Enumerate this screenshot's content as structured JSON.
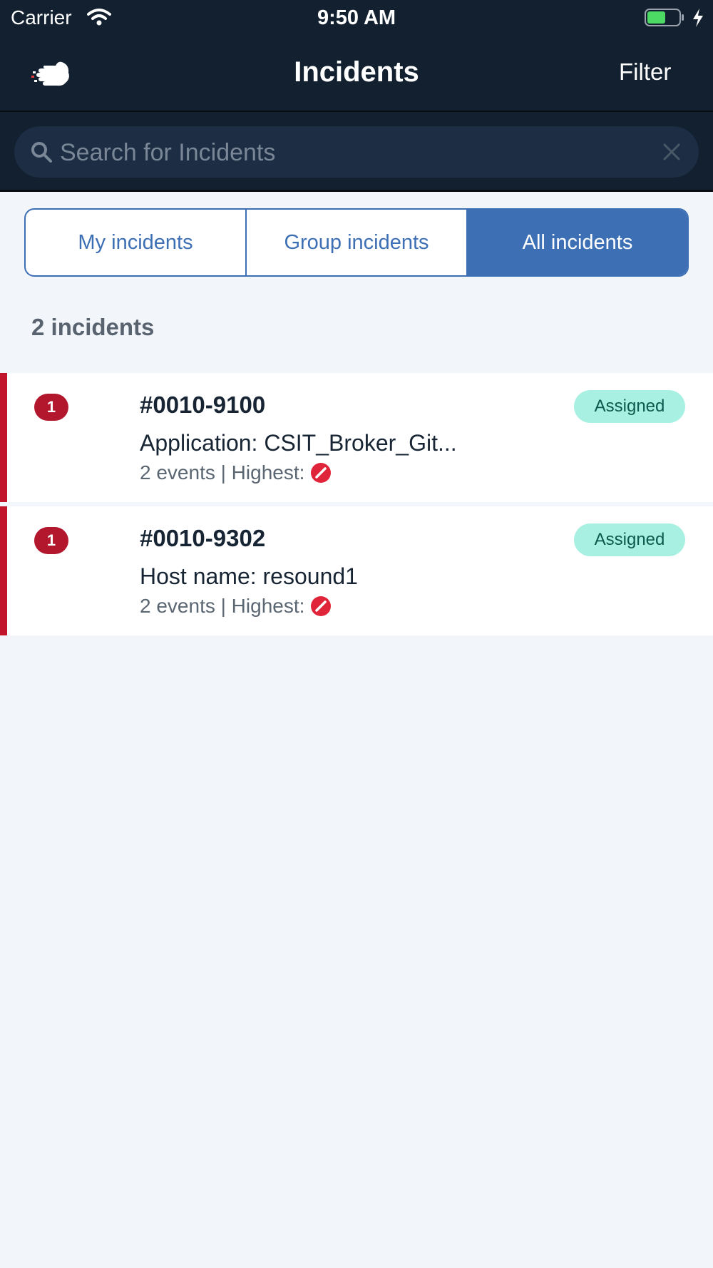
{
  "status_bar": {
    "carrier": "Carrier",
    "time": "9:50 AM"
  },
  "header": {
    "title": "Incidents",
    "filter_label": "Filter",
    "logo_icon": "cloud-hand-logo"
  },
  "search": {
    "placeholder": "Search for Incidents",
    "value": ""
  },
  "tabs": [
    {
      "label": "My incidents",
      "active": false
    },
    {
      "label": "Group incidents",
      "active": false
    },
    {
      "label": "All incidents",
      "active": true
    }
  ],
  "summary": {
    "count_text": "2 incidents"
  },
  "incidents": [
    {
      "priority": "1",
      "id": "#0010-9100",
      "description": "Application: CSIT_Broker_Git...",
      "events_text": "2 events | Highest:",
      "state": "Assigned"
    },
    {
      "priority": "1",
      "id": "#0010-9302",
      "description": "Host name: resound1",
      "events_text": "2 events | Highest:",
      "state": "Assigned"
    }
  ],
  "colors": {
    "nav_bg": "#12202f",
    "accent": "#3d6fb5",
    "critical": "#c0152b",
    "assigned_tag": "#a7f0e2",
    "page_bg": "#f2f5fa"
  }
}
